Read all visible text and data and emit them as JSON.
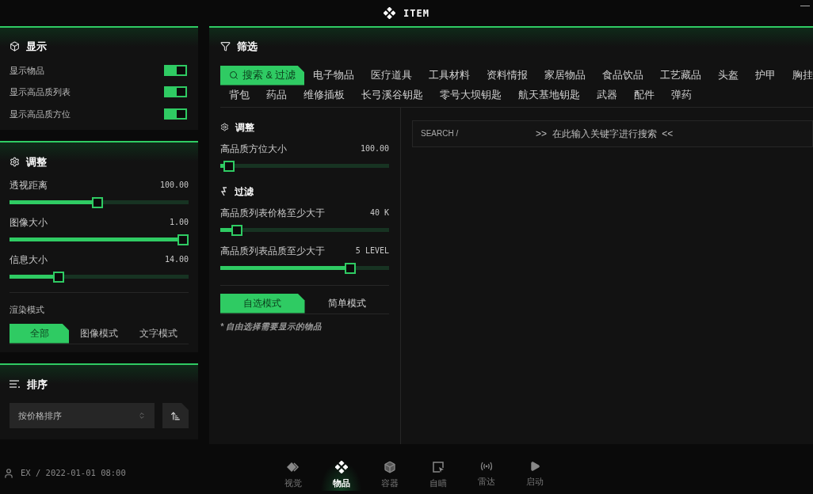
{
  "window": {
    "title": "ITEM",
    "minimize": "—"
  },
  "display": {
    "title": "显示",
    "toggles": [
      {
        "label": "显示物品",
        "on": true
      },
      {
        "label": "显示高品质列表",
        "on": true
      },
      {
        "label": "显示高品质方位",
        "on": true
      }
    ]
  },
  "adjust": {
    "title": "调整",
    "sliders": [
      {
        "label": "透视距离",
        "reading": "100.00",
        "level": 0.49
      },
      {
        "label": "图像大小",
        "reading": "1.00",
        "level": 1
      },
      {
        "label": "信息大小",
        "reading": "14.00",
        "level": 0.26
      }
    ],
    "render_mode": {
      "label": "渲染模式",
      "options": [
        {
          "label": "全部",
          "selected": true
        },
        {
          "label": "图像模式",
          "selected": false
        },
        {
          "label": "文字模式",
          "selected": false
        }
      ]
    }
  },
  "sort": {
    "title": "排序",
    "select": {
      "value": "按价格排序"
    }
  },
  "filter": {
    "title": "筛选",
    "category_rows": [
      {
        "tabs": [
          {
            "label": "搜索 & 过滤",
            "kind": "search",
            "selected": true
          },
          {
            "label": "电子物品",
            "kind": "plain",
            "selected": false
          },
          {
            "label": "医疗道具",
            "kind": "plain",
            "selected": false
          },
          {
            "label": "工具材料",
            "kind": "plain",
            "selected": false
          },
          {
            "label": "资料情报",
            "kind": "plain",
            "selected": false
          },
          {
            "label": "家居物品",
            "kind": "plain",
            "selected": false
          },
          {
            "label": "食品饮品",
            "kind": "plain",
            "selected": false
          },
          {
            "label": "工艺藏品",
            "kind": "plain",
            "selected": false
          },
          {
            "label": "头盔",
            "kind": "plain",
            "selected": false
          },
          {
            "label": "护甲",
            "kind": "plain",
            "selected": false
          },
          {
            "label": "胸挂",
            "kind": "plain",
            "selected": false
          }
        ]
      },
      {
        "tabs": [
          {
            "label": "背包",
            "kind": "plain",
            "selected": false
          },
          {
            "label": "药品",
            "kind": "plain",
            "selected": false
          },
          {
            "label": "维修插板",
            "kind": "plain",
            "selected": false
          },
          {
            "label": "长弓溪谷钥匙",
            "kind": "plain",
            "selected": false
          },
          {
            "label": "零号大坝钥匙",
            "kind": "plain",
            "selected": false
          },
          {
            "label": "航天基地钥匙",
            "kind": "plain",
            "selected": false
          },
          {
            "label": "武器",
            "kind": "plain",
            "selected": false
          },
          {
            "label": "配件",
            "kind": "plain",
            "selected": false
          },
          {
            "label": "弹药",
            "kind": "plain",
            "selected": false
          }
        ]
      }
    ],
    "adjust": {
      "title": "调整",
      "sliders": [
        {
          "label": "高品质方位大小",
          "reading": "100.00",
          "level": 0.02
        }
      ]
    },
    "filtering": {
      "title": "过滤",
      "sliders": [
        {
          "label": "高品质列表价格至少大于",
          "reading": "40 K",
          "level": 0.07
        },
        {
          "label": "高品质列表品质至少大于",
          "reading": "5 LEVEL",
          "level": 0.79
        }
      ]
    },
    "modes": [
      {
        "label": "自选模式",
        "selected": true
      },
      {
        "label": "简单模式",
        "selected": false
      }
    ],
    "note": "* 自由选择需要显示的物品",
    "search": {
      "label": "SEARCH /",
      "placeholder": ">>  在此输入关键字进行搜索  <<"
    }
  },
  "status": {
    "user": "EX / 2022-01-01 08:00"
  },
  "nav": [
    {
      "label": "视觉",
      "kind": "diamond",
      "selected": false
    },
    {
      "label": "物品",
      "kind": "items",
      "selected": true
    },
    {
      "label": "容器",
      "kind": "cube",
      "selected": false
    },
    {
      "label": "自瞄",
      "kind": "screen",
      "selected": false
    },
    {
      "label": "雷达",
      "kind": "radar",
      "selected": false
    },
    {
      "label": "启动",
      "kind": "play",
      "selected": false
    }
  ]
}
